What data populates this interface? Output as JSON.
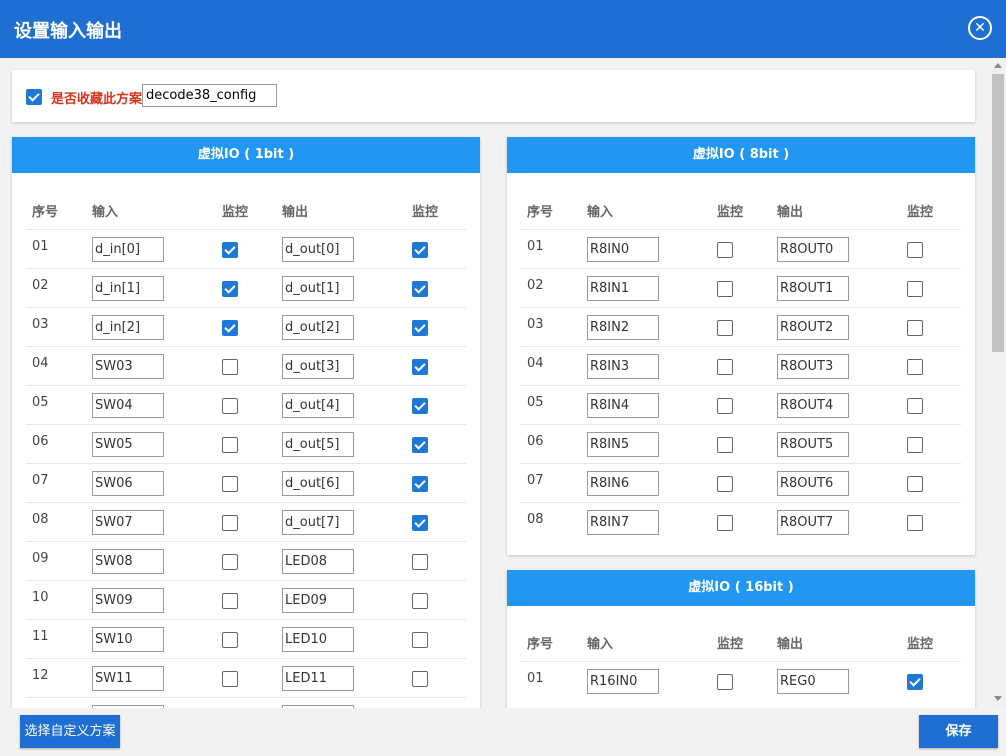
{
  "dialog": {
    "title": "设置输入输出",
    "close_icon": "close-circle-icon"
  },
  "favorite": {
    "checked": true,
    "label": "是否收藏此方案",
    "value": "decode38_config"
  },
  "columns": {
    "idx": "序号",
    "input": "输入",
    "monitor": "监控",
    "output": "输出",
    "monitor2": "监控"
  },
  "panels": {
    "io1": {
      "title": "虚拟IO ( 1bit )",
      "rows": [
        {
          "idx": "01",
          "input": "d_in[0]",
          "in_mon": true,
          "output": "d_out[0]",
          "out_mon": true
        },
        {
          "idx": "02",
          "input": "d_in[1]",
          "in_mon": true,
          "output": "d_out[1]",
          "out_mon": true
        },
        {
          "idx": "03",
          "input": "d_in[2]",
          "in_mon": true,
          "output": "d_out[2]",
          "out_mon": true
        },
        {
          "idx": "04",
          "input": "SW03",
          "in_mon": false,
          "output": "d_out[3]",
          "out_mon": true
        },
        {
          "idx": "05",
          "input": "SW04",
          "in_mon": false,
          "output": "d_out[4]",
          "out_mon": true
        },
        {
          "idx": "06",
          "input": "SW05",
          "in_mon": false,
          "output": "d_out[5]",
          "out_mon": true
        },
        {
          "idx": "07",
          "input": "SW06",
          "in_mon": false,
          "output": "d_out[6]",
          "out_mon": true
        },
        {
          "idx": "08",
          "input": "SW07",
          "in_mon": false,
          "output": "d_out[7]",
          "out_mon": true
        },
        {
          "idx": "09",
          "input": "SW08",
          "in_mon": false,
          "output": "LED08",
          "out_mon": false
        },
        {
          "idx": "10",
          "input": "SW09",
          "in_mon": false,
          "output": "LED09",
          "out_mon": false
        },
        {
          "idx": "11",
          "input": "SW10",
          "in_mon": false,
          "output": "LED10",
          "out_mon": false
        },
        {
          "idx": "12",
          "input": "SW11",
          "in_mon": false,
          "output": "LED11",
          "out_mon": false
        },
        {
          "idx": "",
          "input": "",
          "in_mon": false,
          "output": "",
          "out_mon": false
        }
      ]
    },
    "io8": {
      "title": "虚拟IO ( 8bit )",
      "rows": [
        {
          "idx": "01",
          "input": "R8IN0",
          "in_mon": false,
          "output": "R8OUT0",
          "out_mon": false
        },
        {
          "idx": "02",
          "input": "R8IN1",
          "in_mon": false,
          "output": "R8OUT1",
          "out_mon": false
        },
        {
          "idx": "03",
          "input": "R8IN2",
          "in_mon": false,
          "output": "R8OUT2",
          "out_mon": false
        },
        {
          "idx": "04",
          "input": "R8IN3",
          "in_mon": false,
          "output": "R8OUT3",
          "out_mon": false
        },
        {
          "idx": "05",
          "input": "R8IN4",
          "in_mon": false,
          "output": "R8OUT4",
          "out_mon": false
        },
        {
          "idx": "06",
          "input": "R8IN5",
          "in_mon": false,
          "output": "R8OUT5",
          "out_mon": false
        },
        {
          "idx": "07",
          "input": "R8IN6",
          "in_mon": false,
          "output": "R8OUT6",
          "out_mon": false
        },
        {
          "idx": "08",
          "input": "R8IN7",
          "in_mon": false,
          "output": "R8OUT7",
          "out_mon": false
        }
      ]
    },
    "io16": {
      "title": "虚拟IO ( 16bit )",
      "rows": [
        {
          "idx": "01",
          "input": "R16IN0",
          "in_mon": false,
          "output": "REG0",
          "out_mon": true
        }
      ]
    }
  },
  "footer": {
    "custom_label": "选择自定义方案",
    "save_label": "保存"
  },
  "colors": {
    "titlebar": "#1e6fd1",
    "panel_header": "#2196f3",
    "accent": "#1e78d7",
    "favorite_label": "#d9331c"
  }
}
